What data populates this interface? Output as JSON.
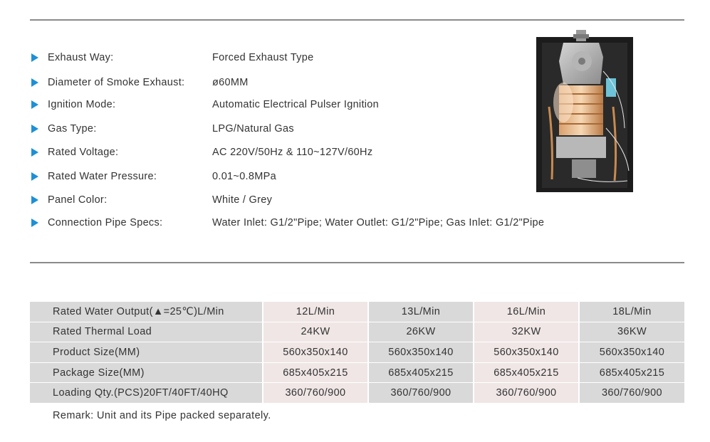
{
  "specs": [
    {
      "label": "Exhaust Way:",
      "value": "Forced Exhaust Type"
    },
    {
      "label": "Diameter of Smoke Exhaust:",
      "value": "ø60MM"
    },
    {
      "label": "Ignition Mode:",
      "value": "Automatic Electrical Pulser Ignition"
    },
    {
      "label": "Gas Type:",
      "value": "LPG/Natural Gas"
    },
    {
      "label": "Rated Voltage:",
      "value": "AC 220V/50Hz & 110~127V/60Hz"
    },
    {
      "label": "Rated Water Pressure:",
      "value": "0.01~0.8MPa"
    },
    {
      "label": "Panel Color:",
      "value": "White / Grey"
    },
    {
      "label": "Connection Pipe Specs:",
      "value": "Water Inlet: G1/2\"Pipe; Water Outlet: G1/2\"Pipe; Gas Inlet: G1/2\"Pipe"
    }
  ],
  "table": {
    "rows": [
      {
        "label": "Rated Water Output(▲=25℃)L/Min",
        "values": [
          "12L/Min",
          "13L/Min",
          "16L/Min",
          "18L/Min"
        ]
      },
      {
        "label": "Rated Thermal Load",
        "values": [
          "24KW",
          "26KW",
          "32KW",
          "36KW"
        ]
      },
      {
        "label": "Product Size(MM)",
        "values": [
          "560x350x140",
          "560x350x140",
          "560x350x140",
          "560x350x140"
        ]
      },
      {
        "label": "Package Size(MM)",
        "values": [
          "685x405x215",
          "685x405x215",
          "685x405x215",
          "685x405x215"
        ]
      },
      {
        "label": "Loading Qty.(PCS)20FT/40FT/40HQ",
        "values": [
          "360/760/900",
          "360/760/900",
          "360/760/900",
          "360/760/900"
        ]
      }
    ]
  },
  "remark": "Remark:  Unit and its Pipe packed separately.",
  "colors": {
    "bullet": "#1e90d6",
    "cell_grey": "#d9d9d9",
    "cell_pink": "#f0e6e6",
    "rule": "#8a8a8a"
  }
}
